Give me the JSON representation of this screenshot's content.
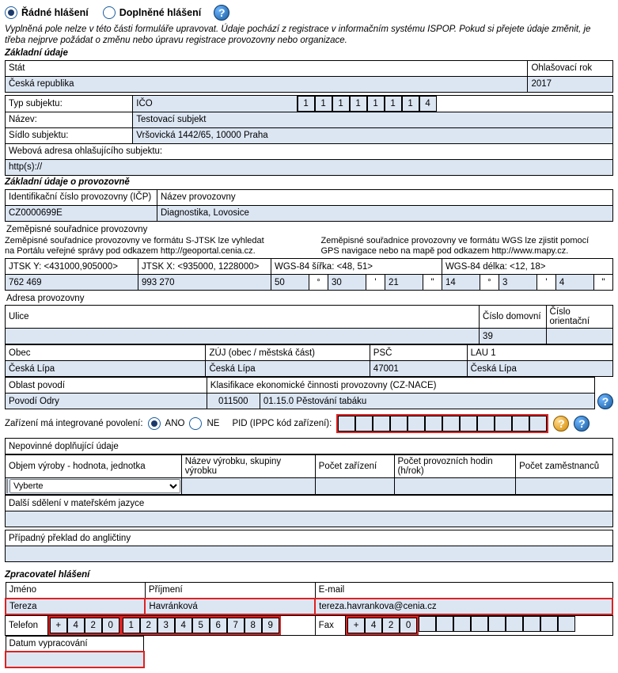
{
  "header": {
    "radio_regular": "Řádné hlášení",
    "radio_supplement": "Doplněné hlášení",
    "intro": "Vyplněná pole nelze v této části formuláře upravovat. Údaje pochází z registrace v informačním systému ISPOP. Pokud si přejete údaje změnit, je třeba nejprve požádat o změnu nebo úpravu registrace provozovny nebo organizace."
  },
  "basic": {
    "title": "Základní údaje",
    "stat_label": "Stát",
    "ohlas_label": "Ohlašovací rok",
    "stat_value": "Česká republika",
    "year_value": "2017",
    "typ_label": "Typ subjektu:",
    "ico_label": "IČO",
    "ico_digits": [
      "1",
      "1",
      "1",
      "1",
      "1",
      "1",
      "1",
      "4"
    ],
    "nazev_label": "Název:",
    "nazev_value": "Testovací subjekt",
    "sidlo_label": "Sídlo subjektu:",
    "sidlo_value": "Vršovická 1442/65, 10000 Praha",
    "web_label": "Webová adresa ohlašujícího subjektu:",
    "web_value": "http(s)://"
  },
  "facility": {
    "title": "Základní údaje o provozovně",
    "icp_label": "Identifikační číslo provozovny (IČP)",
    "icp_value": "CZ0000699E",
    "naz_label": "Název provozovny",
    "naz_value": "Diagnostika, Lovosice",
    "coords_title": "Zeměpisné souřadnice provozovny",
    "note_left1": "Zeměpisné souřadnice provozovny ve formátu S-JTSK lze vyhledat",
    "note_left2": "na Portálu veřejné správy pod odkazem http://geoportal.cenia.cz.",
    "note_right1": "Zeměpisné souřadnice provozovny ve formátu WGS lze zjistit pomocí",
    "note_right2": "GPS navigace nebo na mapě pod odkazem http://www.mapy.cz.",
    "jtsky_label": "JTSK Y: <431000,905000>",
    "jtskx_label": "JTSK X: <935000, 1228000>",
    "wgs_sirka_label": "WGS-84 šířka: <48, 51>",
    "wgs_delka_label": "WGS-84 délka: <12, 18>",
    "jtsky_value": "762 469",
    "jtskx_value": "993 270",
    "wgs_sirka": {
      "deg": "50",
      "min": "30",
      "sec": "21"
    },
    "wgs_delka": {
      "deg": "14",
      "min": "3",
      "sec": "4"
    }
  },
  "address": {
    "title": "Adresa provozovny",
    "ulice_label": "Ulice",
    "ulice_value": "",
    "cislo_dom_label": "Číslo domovní",
    "cislo_dom_value": "39",
    "cislo_or_label": "Číslo orientační",
    "cislo_or_value": "",
    "obec_label": "Obec",
    "zuj_label": "ZÚJ (obec / městská část)",
    "psc_label": "PSČ",
    "lau_label": "LAU 1",
    "obec_value": "Česká Lípa",
    "zuj_value": "Česká Lípa",
    "psc_value": "47001",
    "lau_value": "Česká Lípa",
    "povodi_label": "Oblast povodí",
    "nace_label": "Klasifikace ekonomické činnosti provozovny (CZ-NACE)",
    "povodi_value": "Povodí Odry",
    "nace_code": "011500",
    "nace_text": "01.15.0 Pěstování tabáku"
  },
  "ippc": {
    "label": "Zařízení má integrované povolení:",
    "ano": "ANO",
    "ne": "NE",
    "pid_label": "PID (IPPC kód zařízení):",
    "digits": [
      "",
      "",
      "",
      "",
      "",
      "",
      "",
      "",
      "",
      "",
      "",
      ""
    ]
  },
  "optional": {
    "title": "Nepovinné doplňující údaje",
    "col1": "Objem výroby - hodnota, jednotka",
    "col2": "Název výrobku, skupiny výrobku",
    "col3": "Počet zařízení",
    "col4": "Počet provozních hodin (h/rok)",
    "col5": "Počet zaměstnanců",
    "select_placeholder": "Vyberte",
    "dalsi_label": "Další sdělení v mateřském jazyce",
    "preklad_label": "Případný překlad do angličtiny"
  },
  "processor": {
    "title": "Zpracovatel hlášení",
    "jmeno_label": "Jméno",
    "prijmeni_label": "Příjmení",
    "email_label": "E-mail",
    "jmeno_value": "Tereza",
    "prijmeni_value": "Havránková",
    "email_value": "tereza.havrankova@cenia.cz",
    "telefon_label": "Telefon",
    "telefon_digits": [
      "+",
      "4",
      "2",
      "0",
      "1",
      "2",
      "3",
      "4",
      "5",
      "6",
      "7",
      "8",
      "9"
    ],
    "fax_label": "Fax",
    "fax_digits": [
      "+",
      "4",
      "2",
      "0",
      "",
      "",
      "",
      "",
      "",
      "",
      "",
      "",
      ""
    ],
    "datum_label": "Datum vypracování",
    "datum_value": ""
  }
}
